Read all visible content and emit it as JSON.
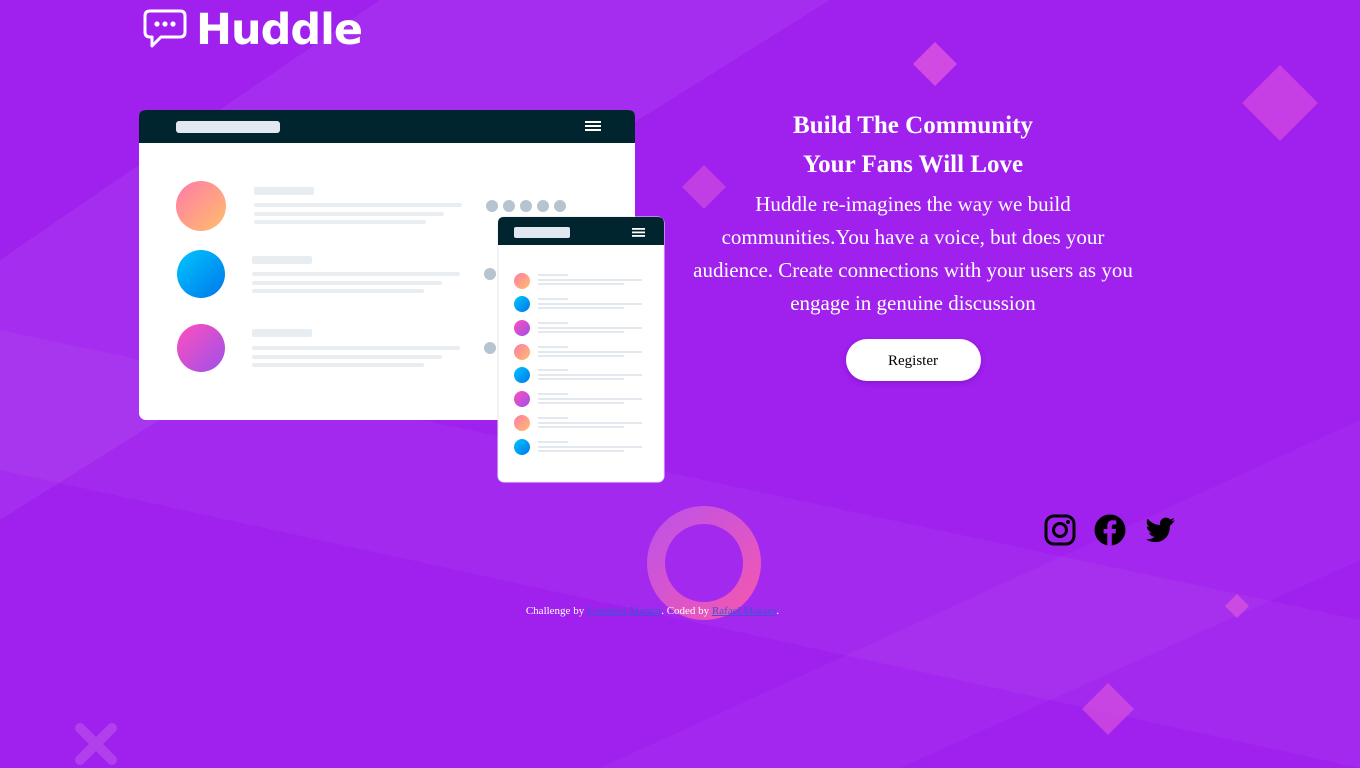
{
  "brand": {
    "name": "Huddle",
    "logo_icon": "speech-bubble-icon"
  },
  "hero": {
    "title_line1": "Build The Community",
    "title_line2": "Your Fans Will Love",
    "description": "Huddle re-imagines the way we build communities.You have a voice, but does your audience. Create connections with your users as you engage in genuine discussion",
    "register_label": "Register"
  },
  "socials": [
    {
      "name": "instagram-icon"
    },
    {
      "name": "facebook-icon"
    },
    {
      "name": "twitter-icon"
    }
  ],
  "attribution": {
    "prefix": "Challenge by ",
    "challenge_link": "Frontend Mentor",
    "middle": ". Coded by ",
    "author_link": "Rafael Moraes",
    "suffix": "."
  },
  "colors": {
    "background": "#a020ee",
    "mockup_header": "#00252e",
    "button_bg": "#ffffff"
  }
}
